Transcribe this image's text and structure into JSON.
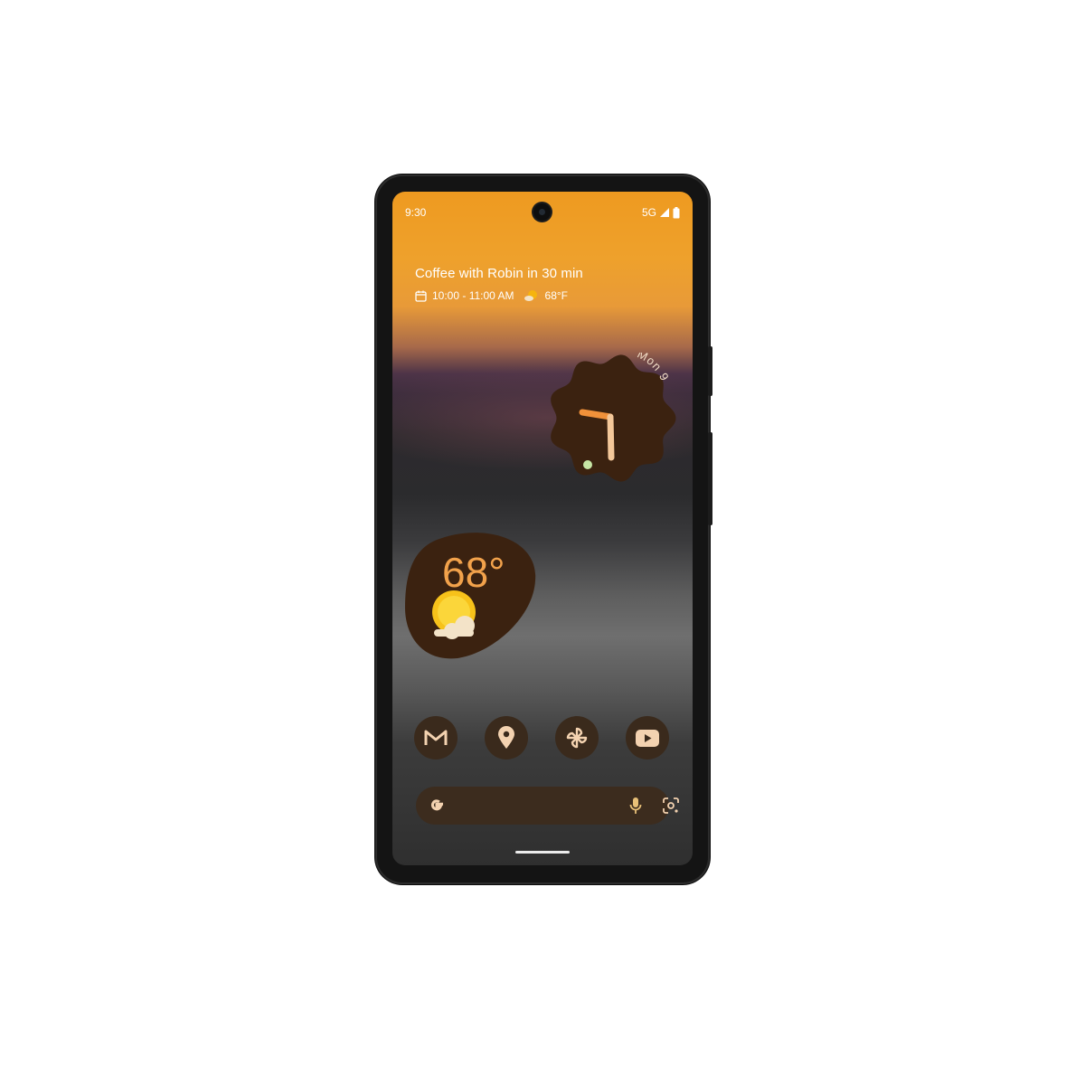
{
  "status_bar": {
    "time": "9:30",
    "network": "5G"
  },
  "at_a_glance": {
    "event": "Coffee with Robin in 30 min",
    "time_range": "10:00 - 11:00 AM",
    "weather_icon": "partly-sunny-icon",
    "temperature": "68°F"
  },
  "clock_widget": {
    "date": "Mon 9"
  },
  "weather_widget": {
    "temperature": "68°",
    "icon": "partly-sunny-icon"
  },
  "dock": [
    {
      "name": "gmail",
      "icon": "gmail-icon"
    },
    {
      "name": "maps",
      "icon": "map-pin-icon"
    },
    {
      "name": "fan",
      "icon": "pinwheel-icon"
    },
    {
      "name": "youtube",
      "icon": "youtube-icon"
    }
  ],
  "search_bar": {
    "logo": "G",
    "voice_icon": "mic-icon",
    "lens_icon": "lens-icon"
  },
  "colors": {
    "accent_orange": "#f2a24b",
    "widget_brown": "#3b2210",
    "dock_brown": "#3a2a1c",
    "wallpaper_top": "#ee9a20"
  }
}
